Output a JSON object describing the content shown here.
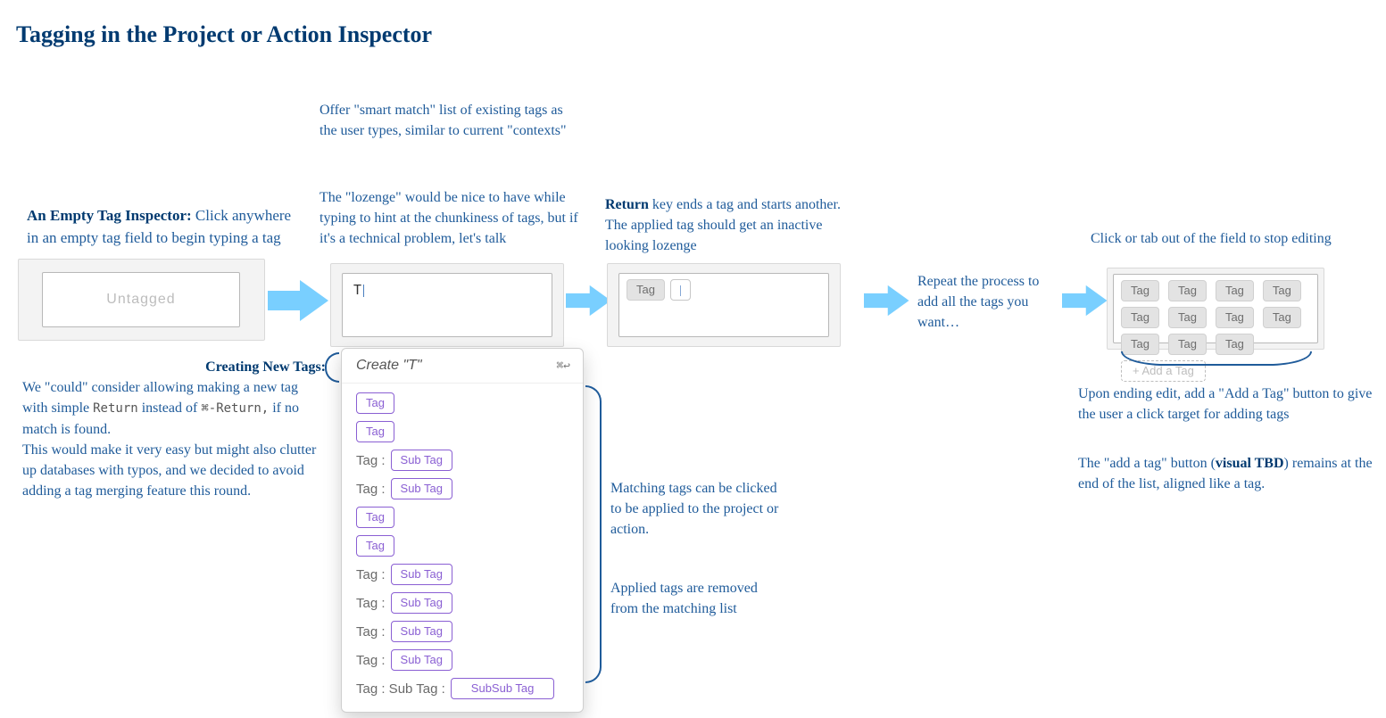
{
  "title": "Tagging in the Project or Action Inspector",
  "step1": {
    "heading": "An Empty Tag Inspector:",
    "text_after": " Click anywhere in an empty tag field to begin typing a tag",
    "placeholder": "Untagged"
  },
  "step2": {
    "note_top": "Offer \"smart match\" list of existing tags as the user types, similar to current \"contexts\"",
    "note_mid": "The \"lozenge\" would be nice to have while typing to hint at the chunkiness of tags, but if it's a technical problem, let's talk",
    "typed": "T"
  },
  "step3": {
    "note_lead_bold": "Return",
    "note_rest": " key ends a tag and starts another. The applied tag should get an inactive looking lozenge",
    "applied_tag": "Tag"
  },
  "creating": {
    "heading": "Creating New Tags:",
    "line1_a": "We \"could\" consider allowing making a new tag with simple ",
    "return_mono": "Return",
    "line1_b": " instead of ",
    "cmd_return_mono": "⌘-Return,",
    "line1_c": " if no match is found.",
    "line2": " This would make it very easy but might also clutter up databases with typos, and we decided to avoid adding a tag merging feature this round."
  },
  "popover": {
    "create_label": "Create \"T\"",
    "shortcut": "⌘↩",
    "rows": [
      {
        "kind": "tag",
        "label": "Tag"
      },
      {
        "kind": "tag",
        "label": "Tag"
      },
      {
        "kind": "sub",
        "prefix": "Tag :",
        "label": "Sub Tag"
      },
      {
        "kind": "sub",
        "prefix": "Tag :",
        "label": "Sub Tag"
      },
      {
        "kind": "tag",
        "label": "Tag"
      },
      {
        "kind": "tag",
        "label": "Tag"
      },
      {
        "kind": "sub",
        "prefix": "Tag :",
        "label": "Sub Tag"
      },
      {
        "kind": "sub",
        "prefix": "Tag :",
        "label": "Sub Tag"
      },
      {
        "kind": "sub",
        "prefix": "Tag :",
        "label": "Sub Tag"
      },
      {
        "kind": "sub",
        "prefix": "Tag :",
        "label": "Sub Tag"
      },
      {
        "kind": "subsub",
        "prefix": "Tag :  Sub Tag :",
        "label": "SubSub Tag"
      }
    ],
    "side_note_a": "Matching tags can be clicked to be applied to the project or action.",
    "side_note_b": "Applied tags are removed from the matching list"
  },
  "step4": {
    "note": "Repeat the process to add all the tags you want…"
  },
  "step5": {
    "note_top": "Click or tab out of the field to stop editing",
    "tags": [
      "Tag",
      "Tag",
      "Tag",
      "Tag",
      "Tag",
      "Tag",
      "Tag",
      "Tag",
      "Tag",
      "Tag",
      "Tag"
    ],
    "add_label": "+ Add a Tag",
    "below_a_pre": "Upon ending edit, add a \"Add a Tag\" button to give the user a click target for adding tags",
    "below_b_pre": "The \"add a tag\" button (",
    "below_b_bold": "visual TBD",
    "below_b_post": ") remains at the end of the list, aligned like a tag."
  }
}
